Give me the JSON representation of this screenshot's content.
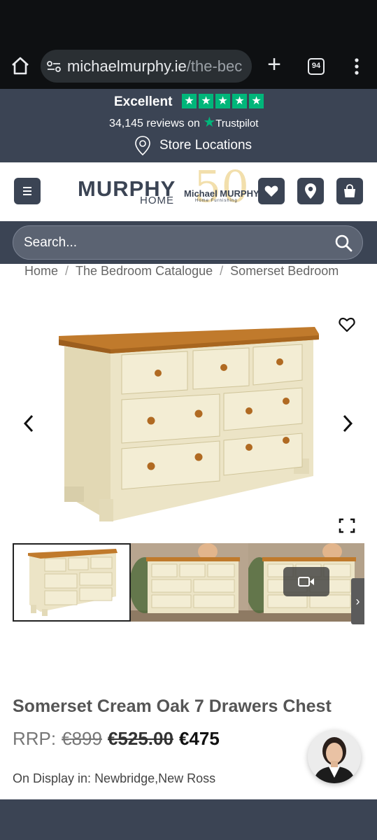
{
  "browser": {
    "url_main": "michaelmurphy.ie",
    "url_rest": "/the-bec",
    "tab_count": "94"
  },
  "trust": {
    "rating_label": "Excellent",
    "reviews_text": "34,145 reviews on",
    "provider": "Trustpilot",
    "stars": 5
  },
  "store": {
    "label": "Store Locations"
  },
  "logo": {
    "main": "MURPHY",
    "sub": "HOME",
    "anniv_number": "50",
    "anniv_name": "Michael MURPHY",
    "anniv_tagline": "Home Furnishing"
  },
  "search": {
    "placeholder": "Search..."
  },
  "breadcrumb": {
    "home": "Home",
    "catalogue": "The Bedroom Catalogue",
    "range": "Somerset Bedroom",
    "separator": "/"
  },
  "product": {
    "title": "Somerset Cream Oak 7 Drawers Chest",
    "rrp_label": "RRP:",
    "rrp_price": "€899",
    "was_price": "€525.00",
    "now_price": "€475",
    "display_label": "On Display in:",
    "display_locations": "Newbridge,New Ross"
  },
  "colors": {
    "brand_navy": "#3b4454",
    "trustpilot_green": "#00b67a",
    "oak": "#c07a2c",
    "cream": "#ece4c6"
  }
}
